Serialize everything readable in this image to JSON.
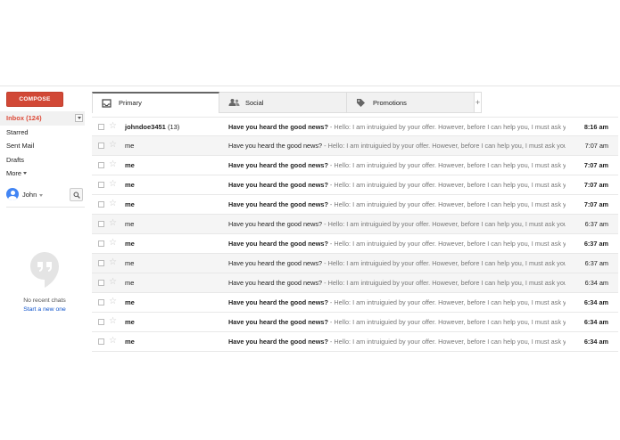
{
  "compose_label": "COMPOSE",
  "nav": {
    "items": [
      {
        "label": "Inbox (124)"
      },
      {
        "label": "Starred"
      },
      {
        "label": "Sent Mail"
      },
      {
        "label": "Drafts"
      },
      {
        "label": "More"
      }
    ]
  },
  "chat": {
    "user_name": "John",
    "no_chats": "No recent chats",
    "start_new": "Start a new one"
  },
  "tabs": [
    {
      "label": "Primary"
    },
    {
      "label": "Social"
    },
    {
      "label": "Promotions"
    },
    {
      "label": "+"
    }
  ],
  "emails": [
    {
      "sender": "johndoe3451",
      "count": "(13)",
      "subject": "Have you heard the good news?",
      "snippet": " - Hello: I am intruiguied by your offer. However, before I can help you, I must ask you a few questions.",
      "time": "8:16 am",
      "unread": true
    },
    {
      "sender": "me",
      "count": "",
      "subject": "Have you heard the good news?",
      "snippet": " - Hello: I am intruiguied by your offer. However, before I can help you, I must ask you a few questions.",
      "time": "7:07 am",
      "unread": false
    },
    {
      "sender": "me",
      "count": "",
      "subject": "Have you heard the good news?",
      "snippet": " - Hello: I am intruiguied by your offer. However, before I can help you, I must ask you a few questions.",
      "time": "7:07 am",
      "unread": true
    },
    {
      "sender": "me",
      "count": "",
      "subject": "Have you heard the good news?",
      "snippet": " - Hello: I am intruiguied by your offer. However, before I can help you, I must ask you a few questions.",
      "time": "7:07 am",
      "unread": true
    },
    {
      "sender": "me",
      "count": "",
      "subject": "Have you heard the good news?",
      "snippet": " - Hello: I am intruiguied by your offer. However, before I can help you, I must ask you a few questions.",
      "time": "7:07 am",
      "unread": true
    },
    {
      "sender": "me",
      "count": "",
      "subject": "Have you heard the good news?",
      "snippet": " - Hello: I am intruiguied by your offer. However, before I can help you, I must ask you a few questions.",
      "time": "6:37 am",
      "unread": false
    },
    {
      "sender": "me",
      "count": "",
      "subject": "Have you heard the good news?",
      "snippet": " - Hello: I am intruiguied by your offer. However, before I can help you, I must ask you a few questions.",
      "time": "6:37 am",
      "unread": true
    },
    {
      "sender": "me",
      "count": "",
      "subject": "Have you heard the good news?",
      "snippet": " - Hello: I am intruiguied by your offer. However, before I can help you, I must ask you a few questions.",
      "time": "6:37 am",
      "unread": false
    },
    {
      "sender": "me",
      "count": "",
      "subject": "Have you heard the good news?",
      "snippet": " - Hello: I am intruiguied by your offer. However, before I can help you, I must ask you a few questions.",
      "time": "6:34 am",
      "unread": false
    },
    {
      "sender": "me",
      "count": "",
      "subject": "Have you heard the good news?",
      "snippet": " - Hello: I am intruiguied by your offer. However, before I can help you, I must ask you a few questions.",
      "time": "6:34 am",
      "unread": true
    },
    {
      "sender": "me",
      "count": "",
      "subject": "Have you heard the good news?",
      "snippet": " - Hello: I am intruiguied by your offer. However, before I can help you, I must ask you a few questions.",
      "time": "6:34 am",
      "unread": true
    },
    {
      "sender": "me",
      "count": "",
      "subject": "Have you heard the good news?",
      "snippet": " - Hello: I am intruiguied by your offer. However, before I can help you, I must ask you a few questions.",
      "time": "6:34 am",
      "unread": true
    }
  ],
  "colors": {
    "compose": "#d14836",
    "inbox_active": "#dd4b39",
    "link": "#1155cc"
  },
  "icons": [
    "inbox-icon",
    "people-icon",
    "tag-icon",
    "star-icon",
    "search-icon",
    "hangouts-icon"
  ]
}
